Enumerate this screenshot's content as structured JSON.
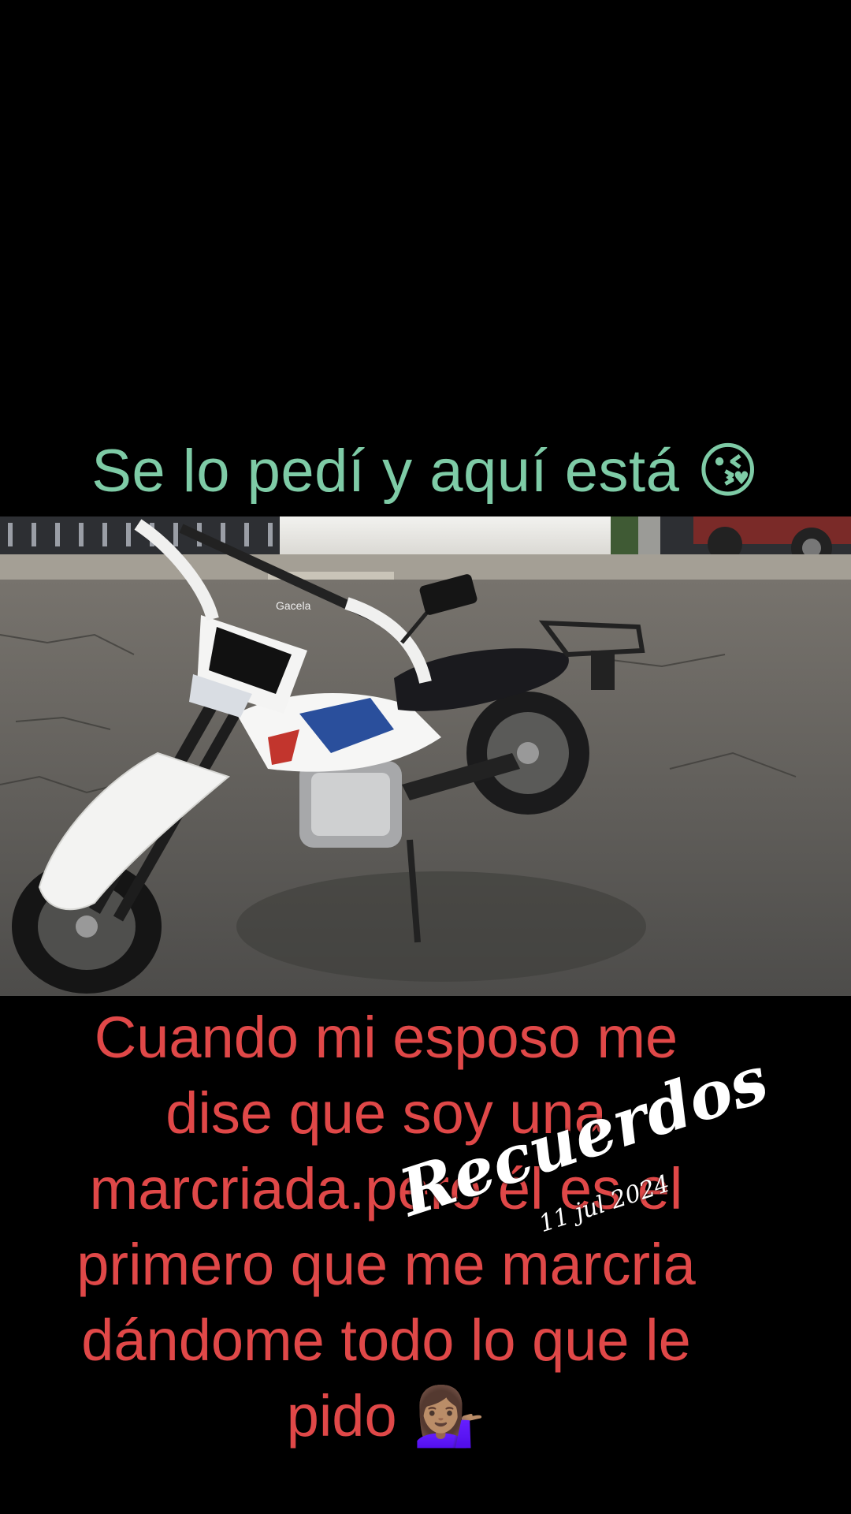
{
  "top_caption": "Se lo pedí y aquí está 😘",
  "photo": {
    "motorcycle_brand_label": "Gacela",
    "description_colors": {
      "bike_primary": "#f4f4f4",
      "bike_accent_blue": "#2a4f9c",
      "bike_accent_red": "#c2352d",
      "seat": "#1a1a1e",
      "pavement": "#5d5d5b"
    }
  },
  "bottom_caption": {
    "lines": [
      "Cuando mi esposo me",
      "dise que soy una",
      "marcriada.pero él es el",
      "primero que me marcria",
      "dándome todo lo que le",
      "pido 💁🏽‍♀️"
    ]
  },
  "sticker": {
    "title": "Recuerdos",
    "date": "11 jul 2024"
  },
  "colors": {
    "background": "#000000",
    "top_caption": "#7ecba6",
    "bottom_caption": "#e04848",
    "sticker_text": "#ffffff"
  }
}
